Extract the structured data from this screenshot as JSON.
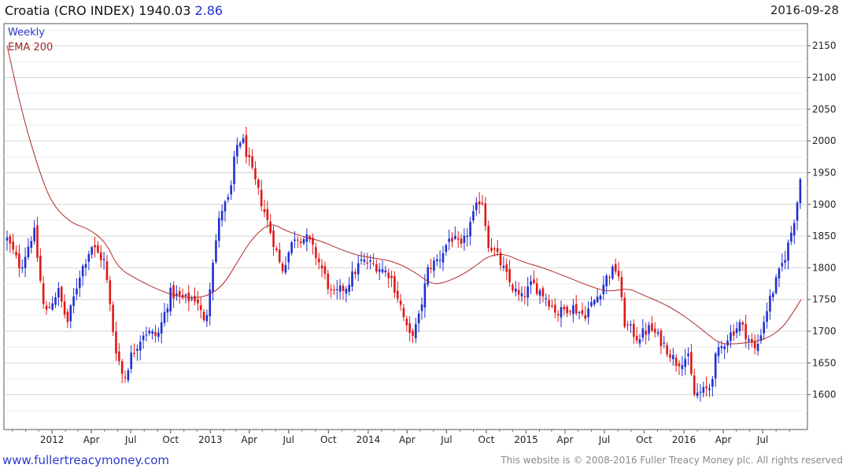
{
  "header": {
    "title": "Croatia (CRO INDEX) 1940.03",
    "change": "2.86",
    "date": "2016-09-28"
  },
  "footer": {
    "site": "www.fullertreacymoney.com",
    "copyright": "This website is © 2008-2016 Fuller Treacy Money plc. All rights reserved"
  },
  "colors": {
    "up": "#1f2fd1",
    "down": "#e01818",
    "ema": "#b02a2a",
    "grid": "#d4d4d4"
  },
  "chart_data": {
    "type": "candlestick",
    "legend": [
      "Weekly",
      "EMA 200"
    ],
    "legend_position": "top-left",
    "y_axis": {
      "position": "right",
      "ylim": [
        1545,
        2185
      ],
      "ticks": [
        1600,
        1650,
        1700,
        1750,
        1800,
        1850,
        1900,
        1950,
        2000,
        2050,
        2100,
        2150
      ]
    },
    "x_axis": {
      "range": [
        "2011-09-19",
        "2016-09-28"
      ],
      "ticks": [
        {
          "label": "2012",
          "date": "2012-01-01"
        },
        {
          "label": "Apr",
          "date": "2012-04-01"
        },
        {
          "label": "Jul",
          "date": "2012-07-01"
        },
        {
          "label": "Oct",
          "date": "2012-10-01"
        },
        {
          "label": "2013",
          "date": "2013-01-01"
        },
        {
          "label": "Apr",
          "date": "2013-04-01"
        },
        {
          "label": "Jul",
          "date": "2013-07-01"
        },
        {
          "label": "Oct",
          "date": "2013-10-01"
        },
        {
          "label": "2014",
          "date": "2014-01-01"
        },
        {
          "label": "Apr",
          "date": "2014-04-01"
        },
        {
          "label": "Jul",
          "date": "2014-07-01"
        },
        {
          "label": "Oct",
          "date": "2014-10-01"
        },
        {
          "label": "2015",
          "date": "2015-01-01"
        },
        {
          "label": "Apr",
          "date": "2015-04-01"
        },
        {
          "label": "Jul",
          "date": "2015-07-01"
        },
        {
          "label": "Oct",
          "date": "2015-10-01"
        },
        {
          "label": "2016",
          "date": "2016-01-01"
        },
        {
          "label": "Apr",
          "date": "2016-04-01"
        },
        {
          "label": "Jul",
          "date": "2016-07-01"
        }
      ]
    },
    "close_series": {
      "name": "Weekly",
      "anchors": [
        [
          "2011-09-19",
          1845
        ],
        [
          "2011-10-20",
          1800
        ],
        [
          "2011-11-20",
          1860
        ],
        [
          "2011-12-15",
          1725
        ],
        [
          "2012-01-15",
          1765
        ],
        [
          "2012-02-05",
          1712
        ],
        [
          "2012-03-05",
          1790
        ],
        [
          "2012-04-01",
          1835
        ],
        [
          "2012-05-01",
          1810
        ],
        [
          "2012-05-25",
          1680
        ],
        [
          "2012-06-15",
          1622
        ],
        [
          "2012-07-01",
          1660
        ],
        [
          "2012-08-01",
          1700
        ],
        [
          "2012-09-01",
          1692
        ],
        [
          "2012-10-01",
          1760
        ],
        [
          "2012-11-01",
          1750
        ],
        [
          "2012-12-01",
          1752
        ],
        [
          "2012-12-20",
          1705
        ],
        [
          "2013-01-05",
          1805
        ],
        [
          "2013-01-25",
          1890
        ],
        [
          "2013-02-15",
          1910
        ],
        [
          "2013-03-01",
          1990
        ],
        [
          "2013-03-15",
          2005
        ],
        [
          "2013-04-10",
          1945
        ],
        [
          "2013-05-10",
          1880
        ],
        [
          "2013-06-01",
          1830
        ],
        [
          "2013-06-15",
          1795
        ],
        [
          "2013-07-15",
          1850
        ],
        [
          "2013-08-15",
          1845
        ],
        [
          "2013-09-15",
          1800
        ],
        [
          "2013-10-10",
          1755
        ],
        [
          "2013-11-10",
          1770
        ],
        [
          "2013-12-15",
          1810
        ],
        [
          "2014-01-15",
          1805
        ],
        [
          "2014-02-20",
          1790
        ],
        [
          "2014-03-15",
          1745
        ],
        [
          "2014-04-05",
          1690
        ],
        [
          "2014-04-25",
          1710
        ],
        [
          "2014-05-20",
          1800
        ],
        [
          "2014-06-15",
          1815
        ],
        [
          "2014-07-10",
          1850
        ],
        [
          "2014-08-05",
          1830
        ],
        [
          "2014-08-25",
          1870
        ],
        [
          "2014-09-20",
          1915
        ],
        [
          "2014-10-05",
          1840
        ],
        [
          "2014-10-25",
          1820
        ],
        [
          "2014-11-25",
          1775
        ],
        [
          "2014-12-20",
          1750
        ],
        [
          "2015-01-15",
          1775
        ],
        [
          "2015-02-15",
          1755
        ],
        [
          "2015-03-15",
          1728
        ],
        [
          "2015-04-15",
          1740
        ],
        [
          "2015-05-15",
          1725
        ],
        [
          "2015-06-15",
          1755
        ],
        [
          "2015-07-10",
          1790
        ],
        [
          "2015-08-01",
          1800
        ],
        [
          "2015-08-15",
          1715
        ],
        [
          "2015-09-15",
          1690
        ],
        [
          "2015-10-15",
          1705
        ],
        [
          "2015-11-15",
          1680
        ],
        [
          "2015-12-15",
          1650
        ],
        [
          "2016-01-10",
          1660
        ],
        [
          "2016-01-25",
          1600
        ],
        [
          "2016-02-15",
          1605
        ],
        [
          "2016-03-01",
          1612
        ],
        [
          "2016-03-15",
          1660
        ],
        [
          "2016-04-10",
          1690
        ],
        [
          "2016-05-10",
          1712
        ],
        [
          "2016-06-15",
          1668
        ],
        [
          "2016-07-15",
          1745
        ],
        [
          "2016-08-10",
          1795
        ],
        [
          "2016-08-25",
          1825
        ],
        [
          "2016-09-10",
          1870
        ],
        [
          "2016-09-28",
          1940
        ]
      ]
    },
    "ema_series": {
      "name": "EMA 200",
      "points": [
        [
          "2011-09-19",
          2150
        ],
        [
          "2011-10-25",
          2040
        ],
        [
          "2011-12-01",
          1955
        ],
        [
          "2012-01-01",
          1900
        ],
        [
          "2012-02-15",
          1870
        ],
        [
          "2012-03-25",
          1862
        ],
        [
          "2012-05-05",
          1840
        ],
        [
          "2012-06-01",
          1800
        ],
        [
          "2012-07-15",
          1782
        ],
        [
          "2012-08-25",
          1768
        ],
        [
          "2012-10-01",
          1758
        ],
        [
          "2012-11-15",
          1752
        ],
        [
          "2012-12-25",
          1755
        ],
        [
          "2013-01-30",
          1772
        ],
        [
          "2013-03-01",
          1805
        ],
        [
          "2013-04-01",
          1840
        ],
        [
          "2013-05-01",
          1862
        ],
        [
          "2013-05-25",
          1870
        ],
        [
          "2013-06-25",
          1858
        ],
        [
          "2013-08-10",
          1848
        ],
        [
          "2013-09-15",
          1842
        ],
        [
          "2013-10-25",
          1830
        ],
        [
          "2013-12-05",
          1820
        ],
        [
          "2014-01-15",
          1815
        ],
        [
          "2014-03-01",
          1810
        ],
        [
          "2014-04-15",
          1795
        ],
        [
          "2014-05-25",
          1775
        ],
        [
          "2014-06-20",
          1775
        ],
        [
          "2014-08-05",
          1788
        ],
        [
          "2014-09-10",
          1805
        ],
        [
          "2014-10-05",
          1818
        ],
        [
          "2014-11-10",
          1823
        ],
        [
          "2014-12-20",
          1810
        ],
        [
          "2015-02-10",
          1800
        ],
        [
          "2015-04-15",
          1783
        ],
        [
          "2015-06-01",
          1770
        ],
        [
          "2015-07-10",
          1762
        ],
        [
          "2015-08-25",
          1768
        ],
        [
          "2015-09-25",
          1758
        ],
        [
          "2015-11-10",
          1745
        ],
        [
          "2015-12-15",
          1732
        ],
        [
          "2016-01-20",
          1715
        ],
        [
          "2016-02-25",
          1695
        ],
        [
          "2016-03-25",
          1680
        ],
        [
          "2016-05-01",
          1680
        ],
        [
          "2016-06-10",
          1683
        ],
        [
          "2016-07-15",
          1690
        ],
        [
          "2016-08-15",
          1705
        ],
        [
          "2016-09-05",
          1725
        ],
        [
          "2016-09-28",
          1750
        ]
      ]
    }
  }
}
